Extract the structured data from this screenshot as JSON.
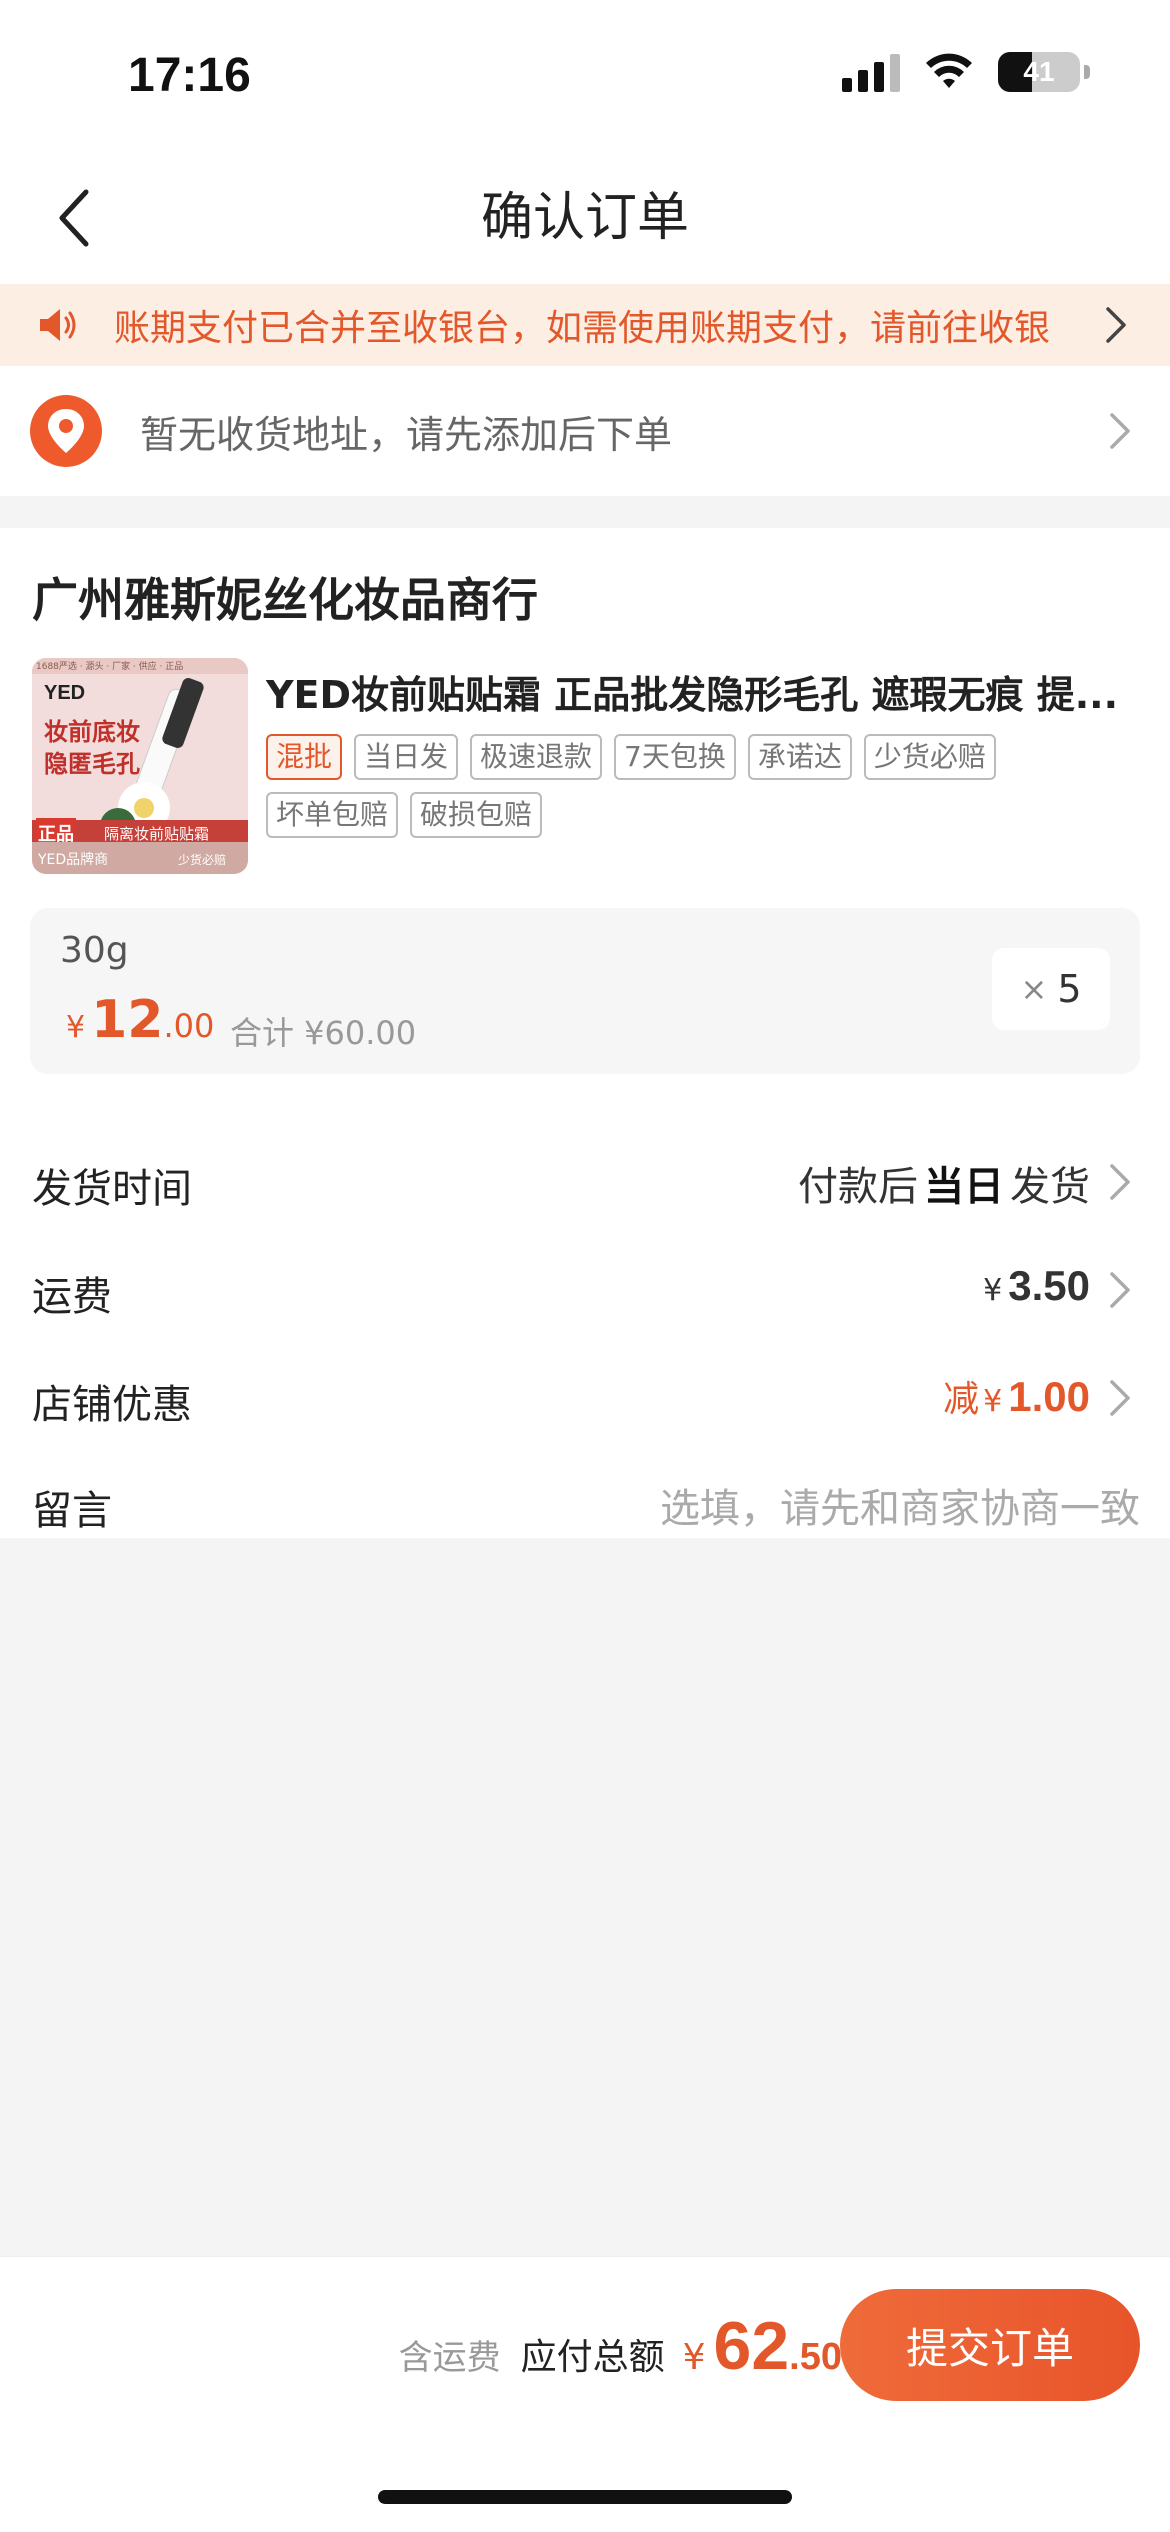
{
  "status_bar": {
    "time": "17:16",
    "battery": "41",
    "battery_level": 0.41
  },
  "header": {
    "title": "确认订单"
  },
  "notice": {
    "text": "账期支付已合并至收银台，如需使用账期支付，请前往收银"
  },
  "address": {
    "text": "暂无收货地址，请先添加后下单"
  },
  "shop": {
    "name": "广州雅斯妮丝化妆品商行",
    "product": {
      "title": "YED妆前贴贴霜 正品批发隐形毛孔 遮瑕无痕 提...",
      "image_texts": {
        "top": "1688严选 · 源头 · 厂家 · 供应 · 正品",
        "brand": "YED",
        "line1": "妆前底妆",
        "line2": "隐匿毛孔",
        "badge": "正品",
        "banner": "隔离妆前贴贴霜",
        "footer_left": "YED品牌商",
        "footer_right": "少货必赔"
      },
      "tags": [
        "混批",
        "当日发",
        "极速退款",
        "7天包换",
        "承诺达",
        "少货必赔",
        "坏单包赔",
        "破损包赔"
      ]
    },
    "sku": {
      "name": "30g",
      "currency": "¥",
      "price_int": "12",
      "price_dec": ".00",
      "total": "合计 ¥60.00",
      "qty_symbol": "×",
      "qty": "5"
    }
  },
  "rows": {
    "delivery": {
      "label": "发货时间",
      "prefix": "付款后",
      "highlight": "当日",
      "suffix": "发货"
    },
    "shipping": {
      "label": "运费",
      "currency": "¥",
      "value": "3.50"
    },
    "discount": {
      "label": "店铺优惠",
      "prefix": "减",
      "currency": "¥",
      "value": "1.00"
    },
    "message": {
      "label": "留言",
      "placeholder": "选填，请先和商家协商一致"
    }
  },
  "footer": {
    "inc_shipping": "含运费",
    "total_label": "应付总额",
    "currency": "¥",
    "total_int": "62",
    "total_dec": ".50",
    "submit": "提交订单"
  },
  "colors": {
    "accent": "#e2582a",
    "notice_bg": "#fdeee4"
  }
}
